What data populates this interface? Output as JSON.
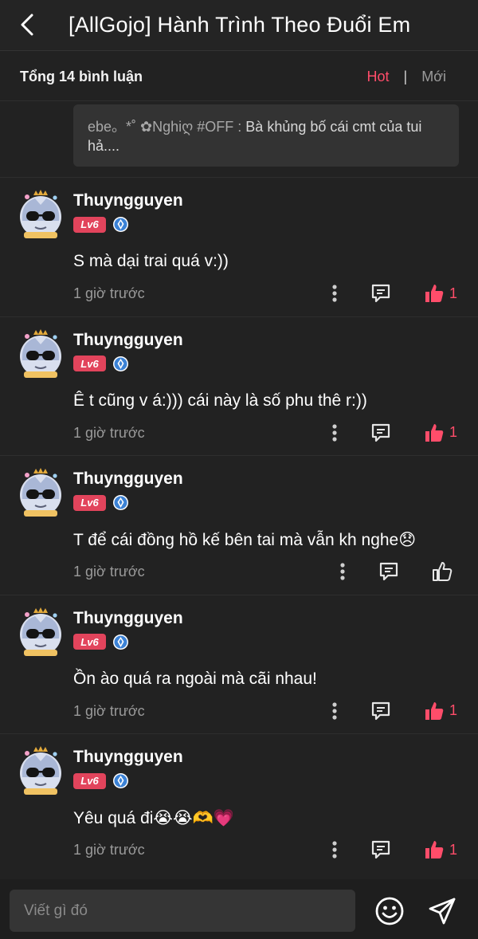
{
  "header": {
    "title": "[AllGojo] Hành Trình Theo Đuổi Em"
  },
  "subbar": {
    "total": "Tổng 14 bình luận",
    "sort_hot": "Hot",
    "sort_sep": "|",
    "sort_new": "Mới"
  },
  "quoted_reply": {
    "user": "ebe。*˚ ✿Nghiღ #OFF :",
    "text": " Bà khủng bố cái cmt của tui hả...."
  },
  "comments": [
    {
      "user": "Thuyngguyen",
      "level": "Lv6",
      "text": "S mà dại trai quá v:))",
      "time": "1 giờ trước",
      "likes": "1",
      "liked": true
    },
    {
      "user": "Thuyngguyen",
      "level": "Lv6",
      "text": "Ê t cũng v á:))) cái này là số phu thê r:))",
      "time": "1 giờ trước",
      "likes": "1",
      "liked": true
    },
    {
      "user": "Thuyngguyen",
      "level": "Lv6",
      "text": "T để cái đồng hồ kế bên tai mà vẫn kh nghe😞",
      "time": "1 giờ trước",
      "likes": "",
      "liked": false
    },
    {
      "user": "Thuyngguyen",
      "level": "Lv6",
      "text": "Ồn ào quá ra ngoài mà cãi nhau!",
      "time": "1 giờ trước",
      "likes": "1",
      "liked": true
    },
    {
      "user": "Thuyngguyen",
      "level": "Lv6",
      "text": "Yêu quá đi😭😭🫶💗",
      "time": "1 giờ trước",
      "likes": "1",
      "liked": true
    }
  ],
  "footer": {
    "placeholder": "Viết gì đó"
  },
  "colors": {
    "accent": "#ff4d6a",
    "background": "#222222",
    "badge": "#e2445c",
    "shield": "#3b82d6"
  },
  "icons": {
    "back": "chevron-left-icon",
    "more": "more-vertical-icon",
    "reply": "comment-icon",
    "like": "thumbs-up-icon",
    "emoji": "smiley-icon",
    "send": "send-icon"
  }
}
